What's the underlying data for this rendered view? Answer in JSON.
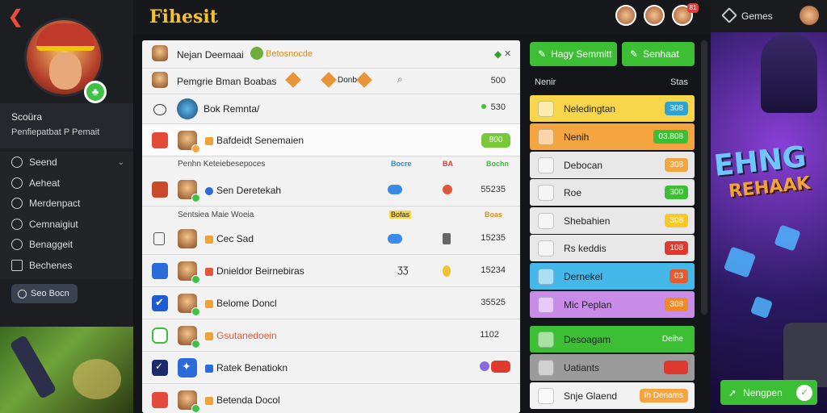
{
  "app_title": "Fihesit",
  "top_right": {
    "games_label": "Gemes"
  },
  "top_badges": {
    "b1": "81"
  },
  "profile": {
    "name": "Scoüra",
    "subtitle": "Penfiepatbat P Pemait"
  },
  "nav": [
    {
      "label": "Seend"
    },
    {
      "label": "Aeheat"
    },
    {
      "label": "Merdenpact"
    },
    {
      "label": "Cemnaigiut"
    },
    {
      "label": "Benaggeit"
    },
    {
      "label": "Bechenes"
    }
  ],
  "side_button": "Seo Bocn",
  "panel": {
    "row1": {
      "title": "Nejan Deemaai",
      "tag": "Betosnocde",
      "close": "✕"
    },
    "row2": {
      "title": "Pemgrie Bman Boabas",
      "extra": "Donb",
      "num": "500"
    },
    "row3": {
      "title": "Bok Remnta/",
      "num": "530"
    },
    "row4": {
      "title": "Bafdeidt Senemaien",
      "pill": "800"
    },
    "sec1": {
      "label": "Penhn Keteiebesepoces",
      "c1": "Bocre",
      "c2": "BA",
      "c3": "Bochn"
    },
    "row5": {
      "title": "Sen Deretekah",
      "num": "55235"
    },
    "sec2": {
      "label": "Sentsiea Maie Woeia",
      "c1": "Bofas",
      "c2": "Boas"
    },
    "row6": {
      "title": "Cec Sad",
      "num": "15235"
    },
    "row7": {
      "title": "Dnieldor Beirnebiras",
      "mid": "ƷƷ",
      "num": "15234"
    },
    "row8": {
      "title": "Belome Doncl",
      "num": "35525"
    },
    "row9": {
      "title": "Gsutanedoein",
      "num": "1102"
    },
    "row10": {
      "title": "Ratek Benatiokn"
    },
    "row11": {
      "title": "Betenda Docol"
    }
  },
  "right": {
    "btn1": "Hagy Semmitt",
    "btn2": "Senhaat",
    "head_left": "Nenir",
    "head_right": "Stas",
    "items": [
      {
        "label": "Neledingtan",
        "badge": "308",
        "bg": "#f7d64a",
        "badge_bg": "#2aa3d9"
      },
      {
        "label": "Nenih",
        "badge": "03.808",
        "bg": "#f4a53f",
        "badge_bg": "#3cbf34"
      },
      {
        "label": "Debocan",
        "badge": "308",
        "bg": "#e8e8e8",
        "badge_bg": "#f4a53f"
      },
      {
        "label": "Roe",
        "badge": "300",
        "bg": "#e8e8e8",
        "badge_bg": "#3cbf34"
      },
      {
        "label": "Shebahien",
        "badge": "308",
        "bg": "#e8e8e8",
        "badge_bg": "#f7c826"
      },
      {
        "label": "Rs keddis",
        "badge": "108",
        "bg": "#e8e8e8",
        "badge_bg": "#e03a2e"
      },
      {
        "label": "Dernekel",
        "badge": "03",
        "bg": "#44b8e8",
        "badge_bg": "#e65a2c"
      },
      {
        "label": "Mic Peplan",
        "badge": "308",
        "bg": "#c88be8",
        "badge_bg": "#f08a28"
      },
      {
        "label": "Desoagam",
        "badge": "Deihe",
        "bg": "#3cbf34",
        "badge_bg": "#3cbf34"
      },
      {
        "label": "Uatiants",
        "badge": "",
        "bg": "#9b9b9b",
        "badge_bg": "#e03a2e"
      },
      {
        "label": "Snje Glaend",
        "badge": "Ih Denams",
        "bg": "#f2f2f2",
        "badge_bg": "#f4a53f"
      }
    ]
  },
  "promo": {
    "logo1": "EHNG",
    "logo2": "REHAAK",
    "button": "Nengpen"
  }
}
